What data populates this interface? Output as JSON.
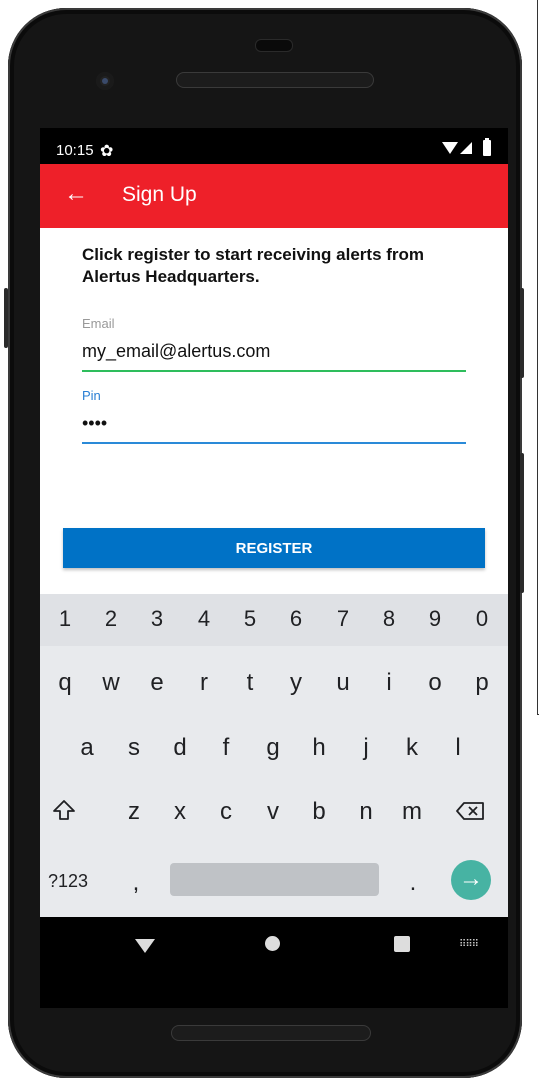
{
  "status_bar": {
    "time": "10:15",
    "icons": [
      "gear-icon",
      "wifi-icon",
      "signal-icon",
      "battery-icon"
    ]
  },
  "app_bar": {
    "title": "Sign Up",
    "back_icon": "arrow-back-icon",
    "color": "#ee2029"
  },
  "content": {
    "intro": "Click register to start receiving alerts from Alertus Headquarters.",
    "email": {
      "label": "Email",
      "value": "my_email@alertus.com"
    },
    "pin": {
      "label": "Pin",
      "value": "••••"
    },
    "register_label": "REGISTER",
    "register_color": "#0072c6"
  },
  "keyboard": {
    "numbers": [
      "1",
      "2",
      "3",
      "4",
      "5",
      "6",
      "7",
      "8",
      "9",
      "0"
    ],
    "row1": [
      "q",
      "w",
      "e",
      "r",
      "t",
      "y",
      "u",
      "i",
      "o",
      "p"
    ],
    "row2": [
      "a",
      "s",
      "d",
      "f",
      "g",
      "h",
      "j",
      "k",
      "l"
    ],
    "row3": [
      "z",
      "x",
      "c",
      "v",
      "b",
      "n",
      "m"
    ],
    "symbols_key": "?123",
    "comma": ",",
    "period": ".",
    "shift_icon": "shift-icon",
    "backspace_icon": "backspace-icon",
    "enter_icon": "arrow-right-icon",
    "enter_color": "#47b3a3"
  },
  "nav_bar": {
    "icons": [
      "nav-back-icon",
      "nav-home-icon",
      "nav-recents-icon",
      "nav-keyboard-icon"
    ]
  }
}
